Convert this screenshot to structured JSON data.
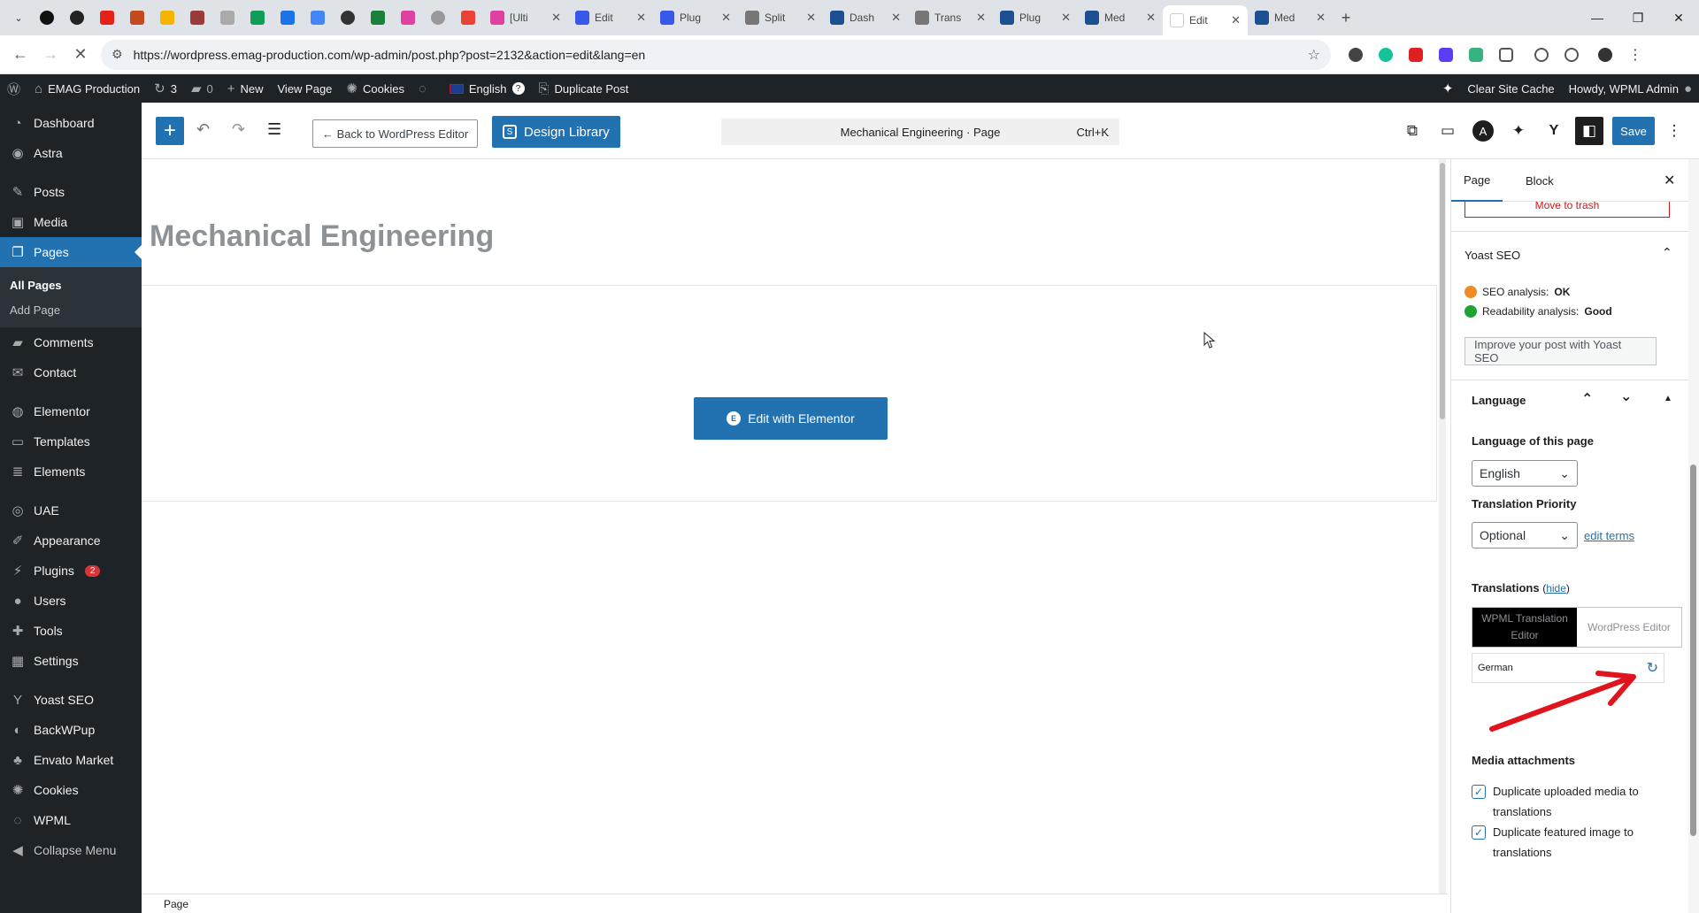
{
  "browser": {
    "tabs": [
      {
        "label": "[Ulti",
        "color": "#e040a0"
      },
      {
        "label": "Edit",
        "color": "#3858e9"
      },
      {
        "label": "Plug",
        "color": "#3858e9"
      },
      {
        "label": "Split",
        "color": "#777777"
      },
      {
        "label": "Dash",
        "color": "#1d4f91"
      },
      {
        "label": "Trans",
        "color": "#777777"
      },
      {
        "label": "Plug",
        "color": "#1d4f91"
      },
      {
        "label": "Med",
        "color": "#1d4f91"
      },
      {
        "label": "Edit",
        "color": "#ffffff"
      },
      {
        "label": "Med",
        "color": "#1d4f91"
      }
    ],
    "url": "https://wordpress.emag-production.com/wp-admin/post.php?post=2132&action=edit&lang=en"
  },
  "adminbar": {
    "site": "EMAG Production",
    "updates": "3",
    "comments": "0",
    "new": "New",
    "view_page": "View Page",
    "cookies": "Cookies",
    "language": "English",
    "duplicate": "Duplicate Post",
    "clear_cache": "Clear Site Cache",
    "howdy": "Howdy, WPML Admin"
  },
  "sidebar": {
    "items": [
      {
        "label": "Dashboard",
        "icon": "dashboard-icon",
        "glyph": "◔"
      },
      {
        "label": "Astra",
        "icon": "astra-icon",
        "glyph": "◉"
      },
      {
        "label": "Posts",
        "icon": "pin-icon",
        "glyph": "✎"
      },
      {
        "label": "Media",
        "icon": "media-icon",
        "glyph": "▣"
      },
      {
        "label": "Pages",
        "icon": "pages-icon",
        "glyph": "❐"
      },
      {
        "label": "Comments",
        "icon": "comments-icon",
        "glyph": "▰"
      },
      {
        "label": "Contact",
        "icon": "mail-icon",
        "glyph": "✉"
      },
      {
        "label": "Elementor",
        "icon": "elementor-icon",
        "glyph": "◍"
      },
      {
        "label": "Templates",
        "icon": "folder-icon",
        "glyph": "▭"
      },
      {
        "label": "Elements",
        "icon": "elements-icon",
        "glyph": "≣"
      },
      {
        "label": "UAE",
        "icon": "uae-icon",
        "glyph": "◎"
      },
      {
        "label": "Appearance",
        "icon": "brush-icon",
        "glyph": "✐"
      },
      {
        "label": "Plugins",
        "icon": "plugin-icon",
        "glyph": "⚡"
      },
      {
        "label": "Users",
        "icon": "user-icon",
        "glyph": "●"
      },
      {
        "label": "Tools",
        "icon": "wrench-icon",
        "glyph": "✚"
      },
      {
        "label": "Settings",
        "icon": "settings-icon",
        "glyph": "▦"
      },
      {
        "label": "Yoast SEO",
        "icon": "yoast-icon",
        "glyph": "Y"
      },
      {
        "label": "BackWPup",
        "icon": "backup-icon",
        "glyph": "◐"
      },
      {
        "label": "Envato Market",
        "icon": "envato-icon",
        "glyph": "♣"
      },
      {
        "label": "Cookies",
        "icon": "cookie-icon",
        "glyph": "✺"
      },
      {
        "label": "WPML",
        "icon": "wpml-icon",
        "glyph": "◌"
      },
      {
        "label": "Collapse Menu",
        "icon": "collapse-icon",
        "glyph": "◀"
      }
    ],
    "submenu": [
      "All Pages",
      "Add Page"
    ],
    "plugins_badge": "2"
  },
  "editor": {
    "back_label": "← Back to WordPress Editor",
    "design_library": "Design Library",
    "command": "Mechanical Engineering · Page",
    "shortcut": "Ctrl+K",
    "save": "Save"
  },
  "canvas": {
    "title": "Mechanical Engineering",
    "edit_elementor": "Edit with Elementor"
  },
  "footer": {
    "breadcrumb": "Page"
  },
  "settings": {
    "tab_page": "Page",
    "tab_block": "Block",
    "move_to_trash": "Move to trash",
    "yoast_title": "Yoast SEO",
    "seo_label": "SEO analysis:",
    "seo_value": "OK",
    "read_label": "Readability analysis:",
    "read_value": "Good",
    "improve": "Improve your post with Yoast SEO",
    "language_title": "Language",
    "lang_of_page": "Language of this page",
    "lang_value": "English",
    "priority_label": "Translation Priority",
    "priority_value": "Optional",
    "edit_terms": "edit terms",
    "translations_label": "Translations",
    "hide": "hide",
    "seg_wpml": "WPML Translation Editor",
    "seg_wp": "WordPress Editor",
    "german": "German",
    "media_title": "Media attachments",
    "dup_media": "Duplicate uploaded media to translations",
    "dup_featured": "Duplicate featured image to translations"
  },
  "colors": {
    "wp_blue": "#2271b1",
    "admin_dark": "#1d2327",
    "seo_ok": "#f08a24",
    "read_good": "#1ea333",
    "annotation_arrow": "#e0141c"
  }
}
